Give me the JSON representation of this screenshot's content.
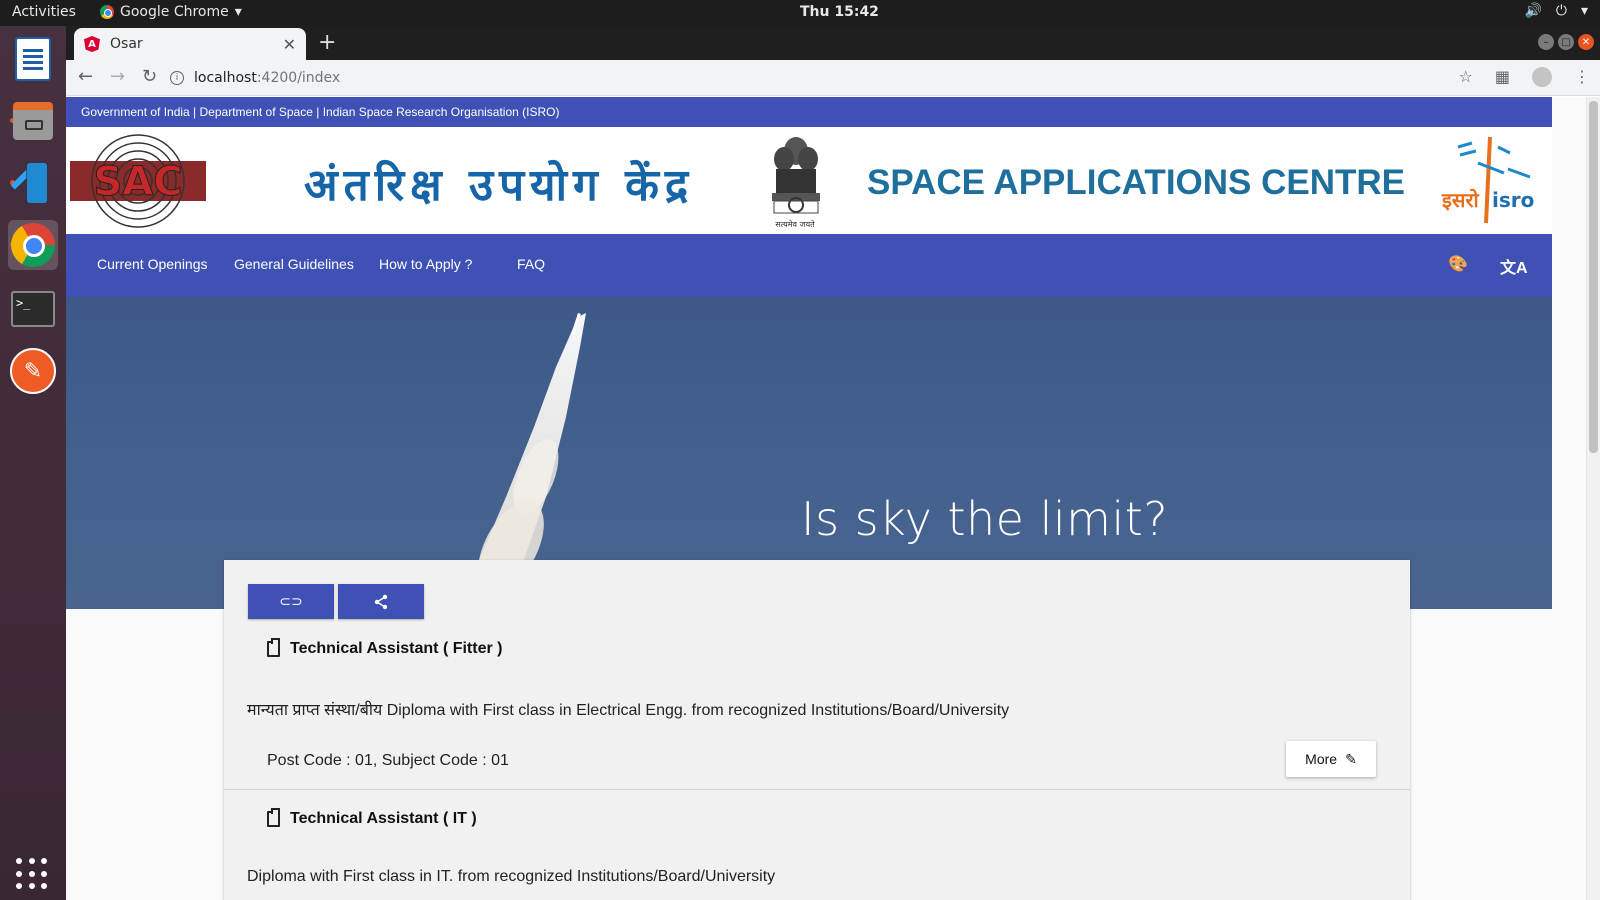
{
  "os": {
    "activities": "Activities",
    "app_name": "Google Chrome",
    "clock": "Thu 15:42"
  },
  "browser": {
    "tab_title": "Osar",
    "url_host": "localhost",
    "url_path": ":4200/index"
  },
  "site": {
    "gov_strip": "Government of India | Department of Space | Indian Space Research Organisation (ISRO)",
    "hindi_title": "अंतरिक्ष उपयोग केंद्र",
    "emblem_motto": "सत्यमेव जयते",
    "english_title": "SPACE APPLICATIONS CENTRE",
    "isro_hindi": "इसरो",
    "isro_en": "isro",
    "nav": [
      {
        "label": "Current Openings"
      },
      {
        "label": "General Guidelines"
      },
      {
        "label": "How to Apply ?"
      },
      {
        "label": "FAQ"
      }
    ],
    "hero_tagline": "Is sky the limit?"
  },
  "jobs": [
    {
      "title": "Technical Assistant ( Fitter )",
      "description": "मान्यता प्राप्त संस्था/बीय Diploma with First class in Electrical Engg. from recognized Institutions/Board/University",
      "codes": "Post Code : 01, Subject Code : 01",
      "more_label": "More"
    },
    {
      "title": "Technical Assistant ( IT )",
      "description": "Diploma with First class in IT. from recognized Institutions/Board/University"
    }
  ],
  "colors": {
    "primary": "#3f51b5",
    "title_blue": "#1565a8",
    "ubuntu_orange": "#e95420"
  }
}
